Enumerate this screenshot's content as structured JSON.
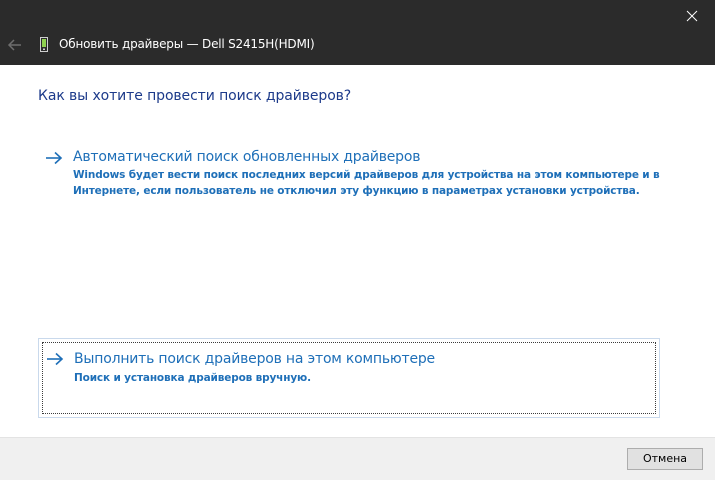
{
  "window": {
    "title": "Обновить драйверы — Dell S2415H(HDMI)",
    "titlebar_color": "#2b2b2b"
  },
  "question": "Как вы хотите провести поиск драйверов?",
  "options": [
    {
      "title": "Автоматический поиск обновленных драйверов",
      "description_lines": [
        "Windows будет вести поиск последних версий драйверов для устройства на этом компьютере и в",
        "Интернете, если пользователь не отключил эту функцию в параметрах установки устройства."
      ]
    },
    {
      "title": "Выполнить поиск драйверов на этом компьютере",
      "description_lines": [
        "Поиск и установка драйверов вручную."
      ]
    }
  ],
  "footer": {
    "cancel_label": "Отмена"
  },
  "colors": {
    "link": "#1e6fb8",
    "heading": "#1c3a8a",
    "footer_bg": "#f0f0f0"
  },
  "icons": {
    "close": "close-icon",
    "back": "back-arrow-icon",
    "device": "monitor-device-icon",
    "option_arrow": "arrow-right-icon"
  }
}
